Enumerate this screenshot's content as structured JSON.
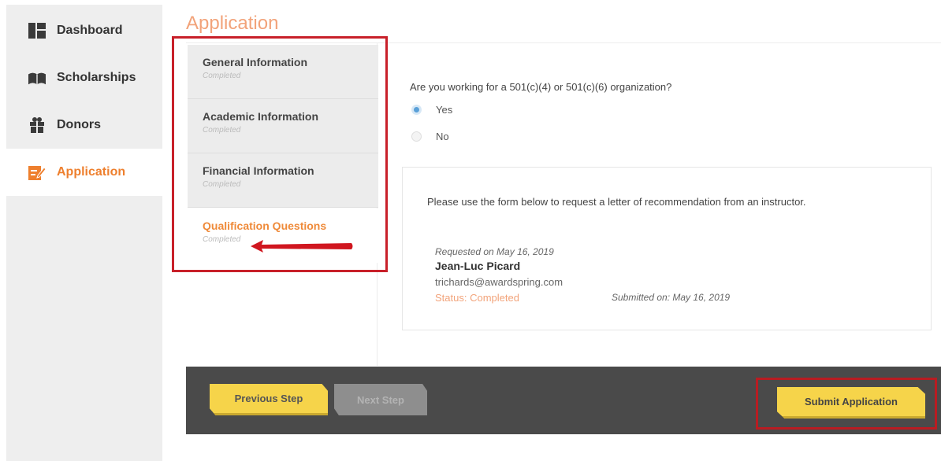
{
  "sidebar": {
    "items": [
      {
        "label": "Dashboard",
        "icon": "dashboard-icon"
      },
      {
        "label": "Scholarships",
        "icon": "book-icon"
      },
      {
        "label": "Donors",
        "icon": "gift-icon"
      },
      {
        "label": "Application",
        "icon": "edit-icon",
        "active": true
      }
    ]
  },
  "page": {
    "title": "Application"
  },
  "steps": [
    {
      "title": "General Information",
      "status": "Completed"
    },
    {
      "title": "Academic Information",
      "status": "Completed"
    },
    {
      "title": "Financial Information",
      "status": "Completed"
    },
    {
      "title": "Qualification Questions",
      "status": "Completed",
      "active": true
    }
  ],
  "question": {
    "text": "Are you working for a 501(c)(4) or 501(c)(6) organization?",
    "options": [
      {
        "label": "Yes",
        "selected": true
      },
      {
        "label": "No",
        "selected": false
      }
    ]
  },
  "recommendation": {
    "instruction": "Please use the form below to request a letter of recommendation from an instructor.",
    "requested_on": "Requested on May 16, 2019",
    "name": "Jean-Luc Picard",
    "email": "trichards@awardspring.com",
    "status": "Status: Completed",
    "submitted_on": "Submitted on: May 16, 2019"
  },
  "actions": {
    "previous": "Previous Step",
    "next": "Next Step",
    "submit": "Submit Application"
  },
  "colors": {
    "accent": "#ee7f2d",
    "button_yellow": "#f6d44a",
    "highlight_red": "#c8202a",
    "radio_blue": "#5aa0d8"
  }
}
